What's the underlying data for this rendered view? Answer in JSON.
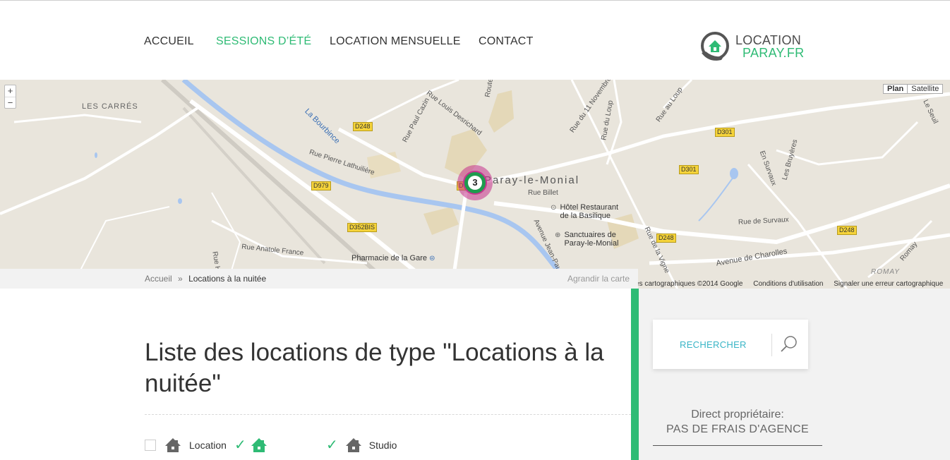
{
  "nav": {
    "items": [
      {
        "label": "ACCUEIL",
        "active": false
      },
      {
        "label": "SESSIONS D’ÉTÉ",
        "active": true
      },
      {
        "label": "LOCATION MENSUELLE",
        "active": false
      },
      {
        "label": "CONTACT",
        "active": false
      }
    ]
  },
  "logo": {
    "line1": "LOCATION",
    "line2": "PARAY.FR",
    "icon": "house-hand-icon"
  },
  "map": {
    "zoom_in": "+",
    "zoom_out": "−",
    "type_plan": "Plan",
    "type_satellite": "Satellite",
    "cluster_count": "3",
    "labels": {
      "les_carres": "LES CARRÉS",
      "bourbince": "La Bourbince",
      "pierre_lathuiliere": "Rue Pierre Lathuilière",
      "paul_cazin": "Rue Paul Cazin",
      "louis_desrichard": "Rue Louis Desrichard",
      "route": "Route",
      "onze_nov": "Rue du 11 Novembre",
      "loup": "Rue du Loup",
      "loup2": "Rue au Loup",
      "billet": "Rue Billet",
      "paray": "Paray-le-Monial",
      "anatole": "Rue Anatole France",
      "jean_paul": "Avenue Jean-Paul",
      "vigne": "Rue de la Vigne",
      "charolles": "Avenue de Charolles",
      "survaux": "Rue de Survaux",
      "en_survaux": "En Survaux",
      "bruyeres": "Les Bruyères",
      "romay": "ROMAY",
      "romay2": "Romay",
      "seuil": "Le Seuil",
      "rue_h": "Rue H"
    },
    "routes": {
      "d248a": "D248",
      "d248b": "D248",
      "d248c": "D248",
      "d979": "D979",
      "d352": "D352BIS",
      "d301a": "D301",
      "d301b": "D301",
      "d2": "D"
    },
    "poi": {
      "hotel": "Hôtel Restaurant de la Basilique",
      "sanctuaires": "Sanctuaires de Paray-le-Monial",
      "pharmacie": "Pharmacie de la Gare"
    },
    "footer": {
      "data": "es cartographiques ©2014 Google",
      "terms": "Conditions d'utilisation",
      "report": "Signaler une erreur cartographique"
    },
    "colors": {
      "water": "#a8c6f0",
      "road": "#ffffff",
      "land": "#e9e5dc",
      "park": "#e4d8b8"
    }
  },
  "breadcrumb": {
    "home": "Accueil",
    "sep": "»",
    "current": "Locations à la nuitée",
    "enlarge": "Agrandir la carte"
  },
  "main": {
    "title": "Liste des locations de type \"Locations à la nuitée\"",
    "filters": {
      "location": "Location",
      "studio": "Studio"
    }
  },
  "sidebar": {
    "search_label": "RECHERCHER",
    "owner_line1": "Direct propriétaire:",
    "owner_line2": "PAS DE FRAIS D'AGENCE"
  },
  "colors": {
    "accent": "#2fbb75",
    "search": "#39b5c6",
    "cluster": "#c6358f"
  }
}
